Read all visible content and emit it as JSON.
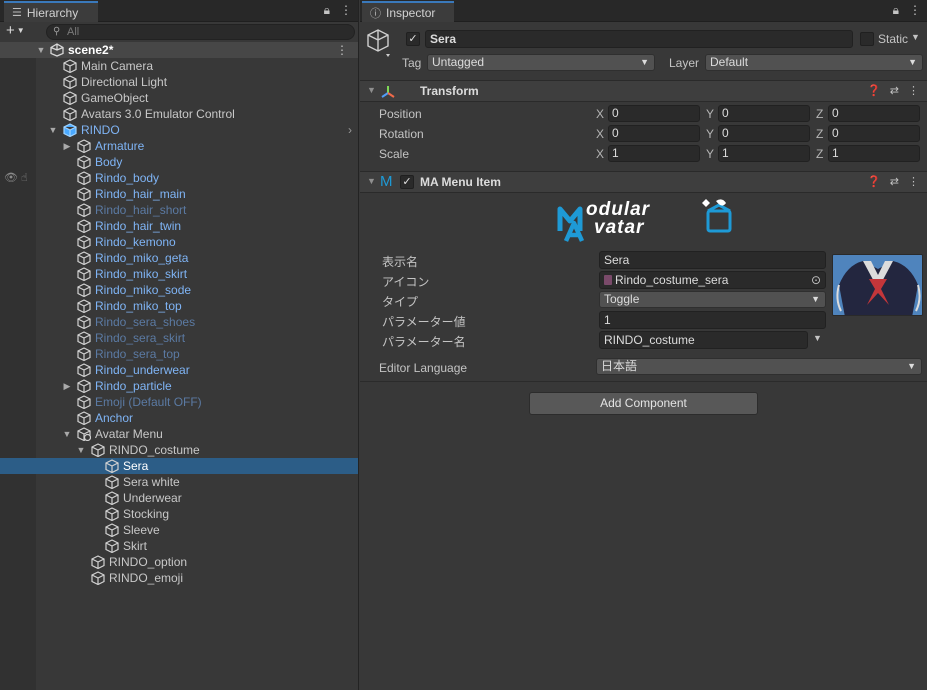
{
  "hierarchy": {
    "tab_label": "Hierarchy",
    "search_placeholder": "All",
    "scene_name": "scene2*",
    "items": [
      {
        "label": "Main Camera"
      },
      {
        "label": "Directional Light"
      },
      {
        "label": "GameObject"
      },
      {
        "label": "Avatars 3.0 Emulator Control"
      },
      {
        "label": "RINDO"
      },
      {
        "label": "Armature"
      },
      {
        "label": "Body"
      },
      {
        "label": "Rindo_body"
      },
      {
        "label": "Rindo_hair_main"
      },
      {
        "label": "Rindo_hair_short"
      },
      {
        "label": "Rindo_hair_twin"
      },
      {
        "label": "Rindo_kemono"
      },
      {
        "label": "Rindo_miko_geta"
      },
      {
        "label": "Rindo_miko_skirt"
      },
      {
        "label": "Rindo_miko_sode"
      },
      {
        "label": "Rindo_miko_top"
      },
      {
        "label": "Rindo_sera_shoes"
      },
      {
        "label": "Rindo_sera_skirt"
      },
      {
        "label": "Rindo_sera_top"
      },
      {
        "label": "Rindo_underwear"
      },
      {
        "label": "Rindo_particle"
      },
      {
        "label": "Emoji (Default OFF)"
      },
      {
        "label": "Anchor"
      },
      {
        "label": "Avatar Menu"
      },
      {
        "label": "RINDO_costume"
      },
      {
        "label": "Sera"
      },
      {
        "label": "Sera white"
      },
      {
        "label": "Underwear"
      },
      {
        "label": "Stocking"
      },
      {
        "label": "Sleeve"
      },
      {
        "label": "Skirt"
      },
      {
        "label": "RINDO_option"
      },
      {
        "label": "RINDO_emoji"
      }
    ]
  },
  "inspector": {
    "tab_label": "Inspector",
    "object_name": "Sera",
    "static_label": "Static",
    "tag_label": "Tag",
    "tag_value": "Untagged",
    "layer_label": "Layer",
    "layer_value": "Default",
    "transform": {
      "title": "Transform",
      "rows": [
        {
          "label": "Position",
          "x": "0",
          "y": "0",
          "z": "0"
        },
        {
          "label": "Rotation",
          "x": "0",
          "y": "0",
          "z": "0"
        },
        {
          "label": "Scale",
          "x": "1",
          "y": "1",
          "z": "1"
        }
      ],
      "axes": [
        "X",
        "Y",
        "Z"
      ]
    },
    "menu_item": {
      "title": "MA Menu Item",
      "logo_line1": "odular",
      "logo_line2": "vatar",
      "logo_m": "M",
      "logo_a": "A",
      "fields": {
        "display_name_label": "表示名",
        "display_name_value": "Sera",
        "icon_label": "アイコン",
        "icon_value": "Rindo_costume_sera",
        "type_label": "タイプ",
        "type_value": "Toggle",
        "param_value_label": "パラメーター値",
        "param_value_value": "1",
        "param_name_label": "パラメーター名",
        "param_name_value": "RINDO_costume"
      },
      "editor_language_label": "Editor Language",
      "editor_language_value": "日本語"
    },
    "add_component_label": "Add Component"
  },
  "colors": {
    "accent": "#3a79bb",
    "selection": "#2c5d87",
    "prefab_blue": "#7fb4f5",
    "ma_blue": "#1e9ad6"
  }
}
